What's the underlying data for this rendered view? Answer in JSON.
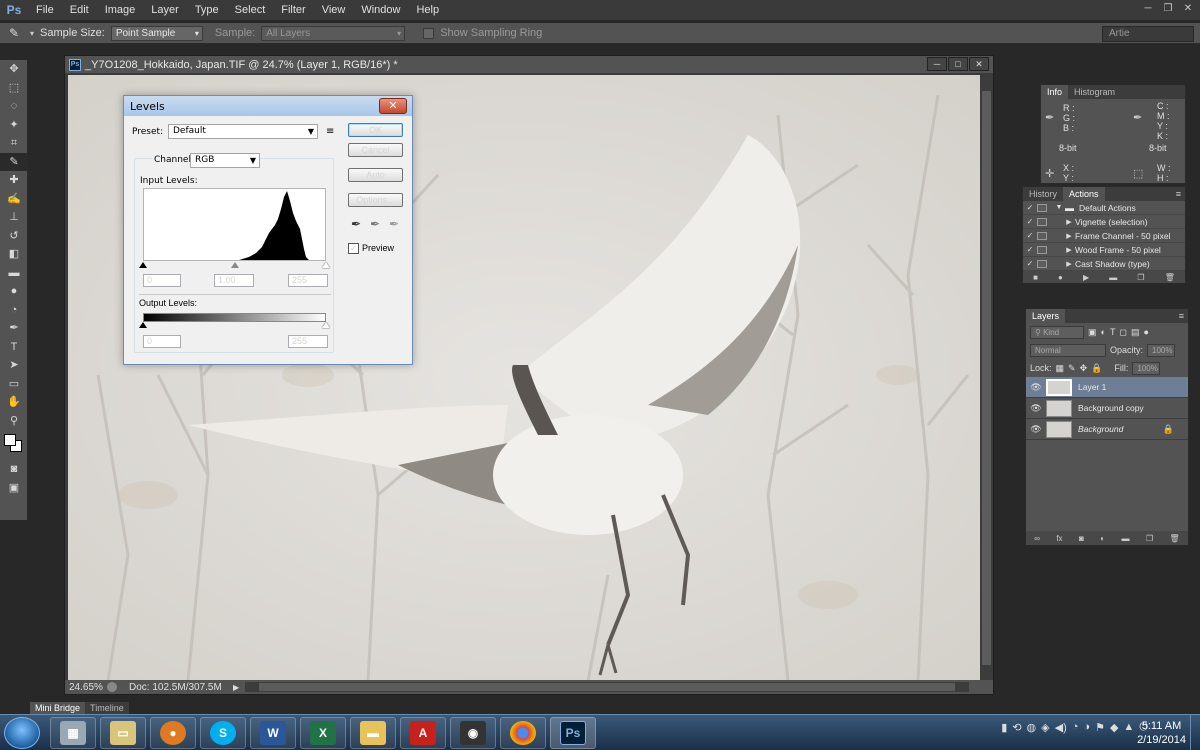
{
  "menubar": {
    "logo": "Ps",
    "items": [
      "File",
      "Edit",
      "Image",
      "Layer",
      "Type",
      "Select",
      "Filter",
      "View",
      "Window",
      "Help"
    ]
  },
  "options": {
    "sample_size_label": "Sample Size:",
    "sample_size_value": "Point Sample",
    "sample_label": "Sample:",
    "sample_value": "All Layers",
    "show_ring": "Show Sampling Ring",
    "workspace": "Artie"
  },
  "document": {
    "title": "_Y7O1208_Hokkaido, Japan.TIF @ 24.7% (Layer 1, RGB/16*) *",
    "zoom": "24.65%",
    "doc_size": "Doc: 102.5M/307.5M"
  },
  "levels": {
    "title": "Levels",
    "preset_label": "Preset:",
    "preset_value": "Default",
    "channel_label": "Channel:",
    "channel_value": "RGB",
    "input_levels_label": "Input Levels:",
    "input_black": "0",
    "input_mid": "1.00",
    "input_white": "255",
    "output_levels_label": "Output Levels:",
    "output_black": "0",
    "output_white": "255",
    "ok": "OK",
    "cancel": "Cancel",
    "auto": "Auto",
    "options": "Options...",
    "preview": "Preview",
    "preview_checked": true
  },
  "info_panel": {
    "tabs": [
      "Info",
      "Histogram"
    ],
    "rgb_labels": "R :\nG :\nB :",
    "cmyk_labels": "C :\nM :\nY :\nK :",
    "bit_left": "8-bit",
    "bit_right": "8-bit",
    "xy": "X :\nY :",
    "wh": "W :\nH :"
  },
  "actions_panel": {
    "tabs": [
      "History",
      "Actions"
    ],
    "items": [
      "Default Actions",
      "Vignette (selection)",
      "Frame Channel - 50 pixel",
      "Wood Frame - 50 pixel",
      "Cast Shadow (type)"
    ]
  },
  "layers_panel": {
    "title": "Layers",
    "filter": "Kind",
    "blend_mode": "Normal",
    "opacity_label": "Opacity:",
    "opacity_value": "100%",
    "lock_label": "Lock:",
    "fill_label": "Fill:",
    "fill_value": "100%",
    "layers": [
      "Layer 1",
      "Background copy",
      "Background"
    ]
  },
  "bottom_tabs": [
    "Mini Bridge",
    "Timeline"
  ],
  "taskbar": {
    "time": "5:11 AM",
    "date": "2/19/2014"
  }
}
